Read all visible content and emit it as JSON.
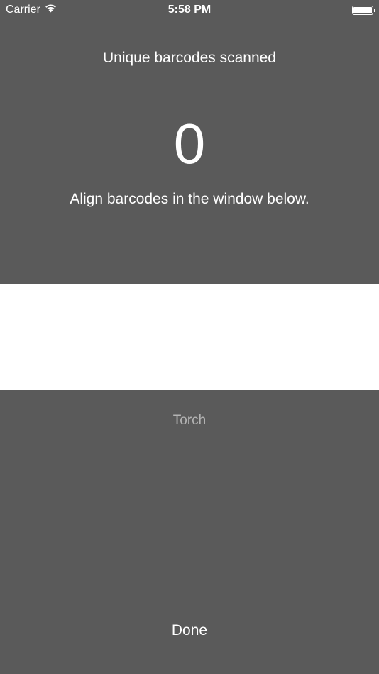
{
  "status_bar": {
    "carrier": "Carrier",
    "time": "5:58 PM",
    "wifi_icon": "wifi-icon",
    "battery_icon": "battery-icon",
    "battery_level": 1.0
  },
  "scanner": {
    "title": "Unique barcodes scanned",
    "count": "0",
    "instructions": "Align barcodes in the window below."
  },
  "controls": {
    "torch_label": "Torch",
    "done_label": "Done"
  },
  "colors": {
    "background": "#5a5a5a",
    "scan_window": "#ffffff",
    "text": "#ffffff",
    "torch_text": "#b4b4b4"
  }
}
